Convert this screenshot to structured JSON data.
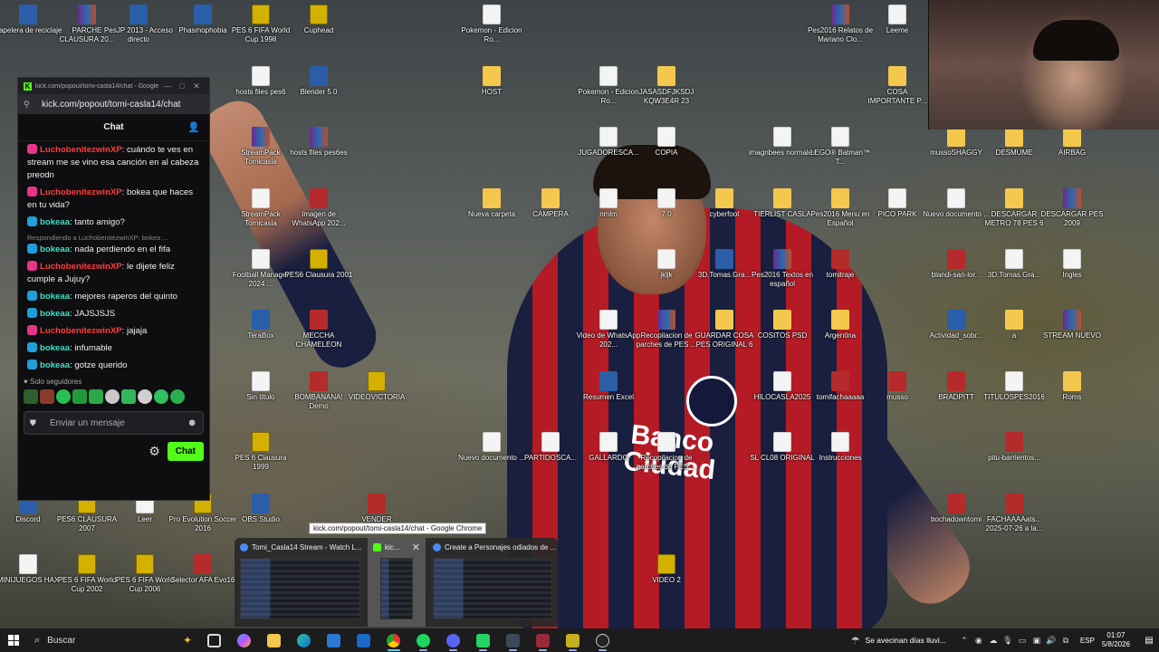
{
  "desktop": {
    "icons": [
      {
        "label": "Papelera de reciclaje",
        "glyph": "trash-icon",
        "kind": "app"
      },
      {
        "label": "PARCHE CLAUSURA 20...",
        "glyph": "rar-icon",
        "kind": "rar"
      },
      {
        "label": "PesJP 2013 - Acceso directo",
        "glyph": "pes-shortcut-icon",
        "kind": "app"
      },
      {
        "label": "Phasmophobia",
        "glyph": "phasmophobia-icon",
        "kind": "app"
      },
      {
        "label": "PES 6 FIFA World Cup 1998",
        "glyph": "pes-icon",
        "kind": "pes"
      },
      {
        "label": "Cuphead",
        "glyph": "cuphead-icon",
        "kind": "pes"
      },
      {
        "label": "Pokemon - Edicion Ro...",
        "glyph": "file-icon",
        "kind": "file"
      },
      {
        "label": "Pes2016 Relatos de Mariano Clo...",
        "glyph": "rar-icon",
        "kind": "rar"
      },
      {
        "label": "Leeme",
        "glyph": "file-icon",
        "kind": "file"
      },
      {
        "label": "hosts files pes6",
        "glyph": "file-icon",
        "kind": "file"
      },
      {
        "label": "Blender 5.0",
        "glyph": "blender-icon",
        "kind": "app"
      },
      {
        "label": "HOST",
        "glyph": "folder-icon",
        "kind": "folder"
      },
      {
        "label": "Pokemon - Edicion Ro...",
        "glyph": "file-icon",
        "kind": "file"
      },
      {
        "label": "JASASDFJKSDJ KQW3E4R 23",
        "glyph": "folder-icon",
        "kind": "folder"
      },
      {
        "label": "COSA IMPORTANTE P...",
        "glyph": "folder-icon",
        "kind": "folder"
      },
      {
        "label": "StreamPack Tomicasla",
        "glyph": "rar-icon",
        "kind": "rar"
      },
      {
        "label": "hosts files pes6es",
        "glyph": "rar-icon",
        "kind": "rar"
      },
      {
        "label": "JUGADORESCA...",
        "glyph": "file-icon",
        "kind": "file"
      },
      {
        "label": "COPIA",
        "glyph": "file-icon",
        "kind": "file"
      },
      {
        "label": "imagnbees normales",
        "glyph": "file-icon",
        "kind": "file"
      },
      {
        "label": "LEGO® Batman™ T...",
        "glyph": "file-icon",
        "kind": "file"
      },
      {
        "label": "mussoSHAGGY",
        "glyph": "folder-icon",
        "kind": "folder"
      },
      {
        "label": "DESMUME",
        "glyph": "folder-icon",
        "kind": "folder"
      },
      {
        "label": "AIRBAG",
        "glyph": "folder-icon",
        "kind": "folder"
      },
      {
        "label": "StreamPack Tomicasla",
        "glyph": "file-icon",
        "kind": "file"
      },
      {
        "label": "Imagen de WhatsApp 202...",
        "glyph": "image-icon",
        "kind": "red"
      },
      {
        "label": "Nueva carpeta",
        "glyph": "folder-icon",
        "kind": "folder"
      },
      {
        "label": "CAMPERA",
        "glyph": "folder-icon",
        "kind": "folder"
      },
      {
        "label": "nmlm",
        "glyph": "file-icon",
        "kind": "file"
      },
      {
        "label": "7.0",
        "glyph": "file-icon",
        "kind": "file"
      },
      {
        "label": "cyberfoot",
        "glyph": "folder-icon",
        "kind": "folder"
      },
      {
        "label": "TIERLIST CASLA",
        "glyph": "folder-icon",
        "kind": "folder"
      },
      {
        "label": "Pes2016 Menu en Español",
        "glyph": "folder-icon",
        "kind": "folder"
      },
      {
        "label": "PICO PARK",
        "glyph": "file-icon",
        "kind": "file"
      },
      {
        "label": "Nuevo documento ...",
        "glyph": "file-icon",
        "kind": "file"
      },
      {
        "label": "DESCARGAR METRO 78 PES 6",
        "glyph": "folder-icon",
        "kind": "folder"
      },
      {
        "label": "DESCARGAR PES 2009",
        "glyph": "rar-icon",
        "kind": "rar"
      },
      {
        "label": "Football Manager 2024 ...",
        "glyph": "file-icon",
        "kind": "file"
      },
      {
        "label": "PES6 Clausura 2001",
        "glyph": "pes-icon",
        "kind": "pes"
      },
      {
        "label": "jkljk",
        "glyph": "file-icon",
        "kind": "file"
      },
      {
        "label": "3D.Tomas.Gra...",
        "glyph": "edge-icon",
        "kind": "app"
      },
      {
        "label": "Pes2016 Textos en español",
        "glyph": "rar-icon",
        "kind": "rar"
      },
      {
        "label": "tomitraje",
        "glyph": "image-icon",
        "kind": "red"
      },
      {
        "label": "blandi-san-lor...",
        "glyph": "image-icon",
        "kind": "red"
      },
      {
        "label": "3D.Tomas.Gra...",
        "glyph": "file-icon",
        "kind": "file"
      },
      {
        "label": "Ingles",
        "glyph": "file-icon",
        "kind": "file"
      },
      {
        "label": "TeraBox",
        "glyph": "terabox-icon",
        "kind": "app"
      },
      {
        "label": "MECCHA CHAMELEON",
        "glyph": "meccha-icon",
        "kind": "red"
      },
      {
        "label": "Video de WhatsApp 202...",
        "glyph": "video-icon",
        "kind": "file"
      },
      {
        "label": "Recopilacion de parches de PES ...",
        "glyph": "rar-icon",
        "kind": "rar"
      },
      {
        "label": "GUARDAR COSA PES ORIGINAL 6",
        "glyph": "folder-icon",
        "kind": "folder"
      },
      {
        "label": "COSITOS PSD",
        "glyph": "folder-icon",
        "kind": "folder"
      },
      {
        "label": "Argentina",
        "glyph": "folder-icon",
        "kind": "folder"
      },
      {
        "label": "Actividad_sobr...",
        "glyph": "app-icon",
        "kind": "app"
      },
      {
        "label": "a",
        "glyph": "folder-icon",
        "kind": "folder"
      },
      {
        "label": "STREAM NUEVO",
        "glyph": "rar-icon",
        "kind": "rar"
      },
      {
        "label": "Sin título",
        "glyph": "file-icon",
        "kind": "file"
      },
      {
        "label": "BOMBANANA! Demo",
        "glyph": "bombanana-icon",
        "kind": "red"
      },
      {
        "label": "VIDEOVICTORIA",
        "glyph": "video-icon",
        "kind": "pes"
      },
      {
        "label": "Resumen Excel",
        "glyph": "excel-icon",
        "kind": "app"
      },
      {
        "label": "HILOCASLA2025",
        "glyph": "file-icon",
        "kind": "file"
      },
      {
        "label": "tomifachaaaaa",
        "glyph": "image-icon",
        "kind": "red"
      },
      {
        "label": "musso",
        "glyph": "image-icon",
        "kind": "red"
      },
      {
        "label": "BRADPITT",
        "glyph": "image-icon",
        "kind": "red"
      },
      {
        "label": "TITULOSPES2016",
        "glyph": "file-icon",
        "kind": "file"
      },
      {
        "label": "Roms",
        "glyph": "folder-icon",
        "kind": "folder"
      },
      {
        "label": "PES 6 Clausura 1999",
        "glyph": "pes-icon",
        "kind": "pes"
      },
      {
        "label": "Nuevo documento ...",
        "glyph": "file-icon",
        "kind": "file"
      },
      {
        "label": "PARTIDOSCA...",
        "glyph": "file-icon",
        "kind": "file"
      },
      {
        "label": "GALLARDO",
        "glyph": "file-icon",
        "kind": "file"
      },
      {
        "label": "Recopilacion de parches de PES ...",
        "glyph": "file-icon",
        "kind": "file"
      },
      {
        "label": "SL CL08 ORIGINAL",
        "glyph": "file-icon",
        "kind": "file"
      },
      {
        "label": "Instrucciones",
        "glyph": "file-icon",
        "kind": "file"
      },
      {
        "label": "pitu-barrientos...",
        "glyph": "image-icon",
        "kind": "red"
      },
      {
        "label": "Discord",
        "glyph": "discord-icon",
        "kind": "app"
      },
      {
        "label": "PES6 CLAUSURA 2007",
        "glyph": "pes-icon",
        "kind": "pes"
      },
      {
        "label": "Leer",
        "glyph": "file-icon",
        "kind": "file"
      },
      {
        "label": "Pro Evolution Soccer 2016",
        "glyph": "pes-icon",
        "kind": "pes"
      },
      {
        "label": "OBS Studio",
        "glyph": "obs-icon",
        "kind": "app"
      },
      {
        "label": "VENDER",
        "glyph": "image-icon",
        "kind": "red"
      },
      {
        "label": "bochadowntomi",
        "glyph": "image-icon",
        "kind": "red"
      },
      {
        "label": "FACHAAAAats... 2025-07-26 a la...",
        "glyph": "image-icon",
        "kind": "red"
      },
      {
        "label": "MINIJUEGOS HAX",
        "glyph": "file-icon",
        "kind": "file"
      },
      {
        "label": "PES 6 FIFA World Cup 2002",
        "glyph": "pes-icon",
        "kind": "pes"
      },
      {
        "label": "PES 6 FIFA World Cup 2006",
        "glyph": "pes-icon",
        "kind": "pes"
      },
      {
        "label": "Selector AFA Evo16",
        "glyph": "afa-icon",
        "kind": "red"
      },
      {
        "label": "VIDEO 2",
        "glyph": "video-icon",
        "kind": "pes"
      }
    ]
  },
  "chat_window": {
    "title": "kick.com/popout/tomi-casla14/chat - Google Chrome",
    "url": "kick.com/popout/tomi-casla14/chat",
    "header": "Chat",
    "messages": [
      {
        "user": "LuchobenitezwinXP",
        "color": "red",
        "text": ": cuándo te ves en stream me se vino esa canción en al cabeza preodn"
      },
      {
        "user": "LuchobenitezwinXP",
        "color": "red",
        "text": ": bokea que haces en tu vida?"
      },
      {
        "user": "bokeaa",
        "color": "teal",
        "text": ": tanto amigo?"
      },
      {
        "reply": "Respondiendo a LuchobenitezwinXP: bokea ...",
        "user": "bokeaa",
        "color": "teal",
        "text": ": nada perdiendo en el fifa"
      },
      {
        "user": "LuchobenitezwinXP",
        "color": "red",
        "text": ": le dijete feliz cumple a Jujuy?"
      },
      {
        "user": "bokeaa",
        "color": "teal",
        "text": ": mejores raperos del quinto"
      },
      {
        "user": "bokeaa",
        "color": "teal",
        "text": ": JAJSJSJS"
      },
      {
        "user": "LuchobenitezwinXP",
        "color": "red",
        "text": ": jajaja"
      },
      {
        "user": "bokeaa",
        "color": "teal",
        "text": ": infumable"
      },
      {
        "user": "bokeaa",
        "color": "teal",
        "text": ": gotze querido"
      }
    ],
    "followers_only": "Solo seguidores",
    "input_placeholder": "Enviar un mensaje",
    "send_label": "Chat"
  },
  "taskbar_preview": {
    "tooltip": "kick.com/popout/tomi-casla14/chat - Google Chrome",
    "windows": [
      {
        "title": "Tomi_Casla14 Stream - Watch L..."
      },
      {
        "title": "kic..."
      },
      {
        "title": "Create a Personajes odiados de ..."
      }
    ]
  },
  "taskbar": {
    "search_placeholder": "Buscar",
    "weather": "Se avecinan días lluvi...",
    "language": "ESP",
    "time": "01:07",
    "date": "5/8/2026",
    "accent": "#53fc18"
  }
}
